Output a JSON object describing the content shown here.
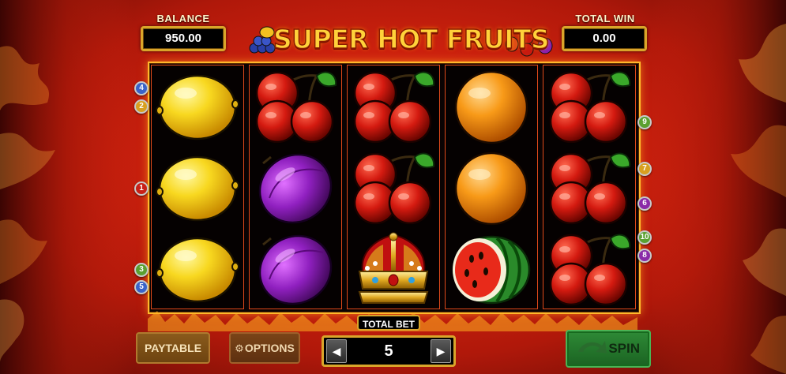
{
  "header": {
    "balance_label": "BALANCE",
    "balance_value": "950.00",
    "win_label": "TOTAL WIN",
    "win_value": "0.00",
    "logo_text": "SUPER HOT FRUITS"
  },
  "reels": [
    [
      "lemon",
      "lemon",
      "lemon"
    ],
    [
      "cherry",
      "plum",
      "plum"
    ],
    [
      "cherry",
      "cherry",
      "crown"
    ],
    [
      "orange",
      "orange",
      "watermelon"
    ],
    [
      "cherry",
      "cherry",
      "cherry"
    ]
  ],
  "paylines": {
    "left": [
      {
        "number": "4",
        "color": "#3a63c8"
      },
      {
        "number": "2",
        "color": "#d8a020"
      },
      {
        "number": "1",
        "color": "#c82018"
      },
      {
        "number": "3",
        "color": "#5aa030"
      },
      {
        "number": "5",
        "color": "#3a63c8"
      }
    ],
    "right": [
      {
        "number": "9",
        "color": "#5aa030"
      },
      {
        "number": "7",
        "color": "#d8a020"
      },
      {
        "number": "6",
        "color": "#8a2aa8"
      },
      {
        "number": "10",
        "color": "#5aa030"
      },
      {
        "number": "8",
        "color": "#8a2aa8"
      }
    ]
  },
  "controls": {
    "paytable_label": "PAYTABLE",
    "options_label": "OPTIONS",
    "total_bet_label": "TOTAL BET",
    "bet_value": "5",
    "spin_label": "SPIN",
    "bet_minus_icon": "arrow-left-icon",
    "bet_plus_icon": "arrow-right-icon"
  }
}
